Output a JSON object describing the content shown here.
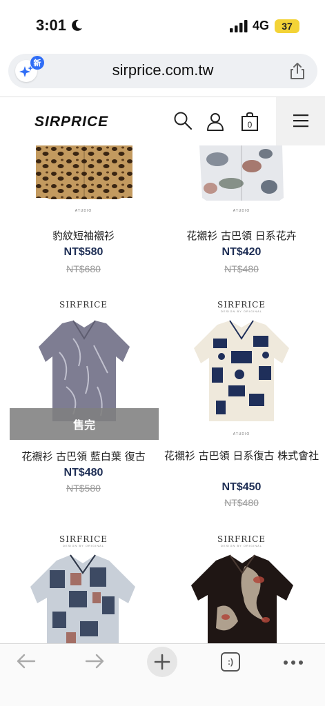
{
  "status_bar": {
    "time": "3:01",
    "network": "4G",
    "battery": "37"
  },
  "browser": {
    "url": "sirprice.com.tw",
    "ai_badge": "新"
  },
  "site": {
    "logo": "SIRPRICE"
  },
  "products": [
    {
      "name": "豹紋短袖襯衫",
      "price": "NT$580",
      "old_price": "NT$680",
      "brand": "",
      "brand_sub": "",
      "studio": "ATUDIO",
      "sold_out": ""
    },
    {
      "name": "花襯衫 古巴領 日系花卉",
      "price": "NT$420",
      "old_price": "NT$480",
      "brand": "",
      "brand_sub": "",
      "studio": "ATUDIO",
      "sold_out": ""
    },
    {
      "name": "花襯衫 古巴領 藍白葉 復古",
      "price": "NT$480",
      "old_price": "NT$580",
      "brand": "SIRFRICE",
      "brand_sub": "",
      "studio": "",
      "sold_out": "售完"
    },
    {
      "name": "花襯衫 古巴領 日系復古 株式會社",
      "price": "NT$450",
      "old_price": "NT$480",
      "brand": "SIRFRICE",
      "brand_sub": "DESIGN BY ORIGINAL",
      "studio": "ATUDIO",
      "sold_out": ""
    },
    {
      "name": "",
      "price": "",
      "old_price": "",
      "brand": "SIRFRICE",
      "brand_sub": "DESIGN BY ORIGINAL",
      "studio": "",
      "sold_out": ""
    },
    {
      "name": "",
      "price": "",
      "old_price": "",
      "brand": "SIRFRICE",
      "brand_sub": "DESIGN BY ORIGINAL",
      "studio": "",
      "sold_out": ""
    }
  ],
  "colors": {
    "price": "#1e2e55",
    "old_price": "#999999",
    "soldout_overlay": "#808080",
    "battery": "#f3d337",
    "url_bar": "#eef0f3"
  },
  "icons": [
    "moon-icon",
    "signal-icon",
    "sparkle-icon",
    "share-icon",
    "search-icon",
    "account-icon",
    "cart-icon",
    "menu-icon",
    "back-arrow-icon",
    "forward-arrow-icon",
    "plus-icon",
    "tabs-icon",
    "more-icon"
  ],
  "toolbar": {
    "tabs_glyph": ":)"
  }
}
